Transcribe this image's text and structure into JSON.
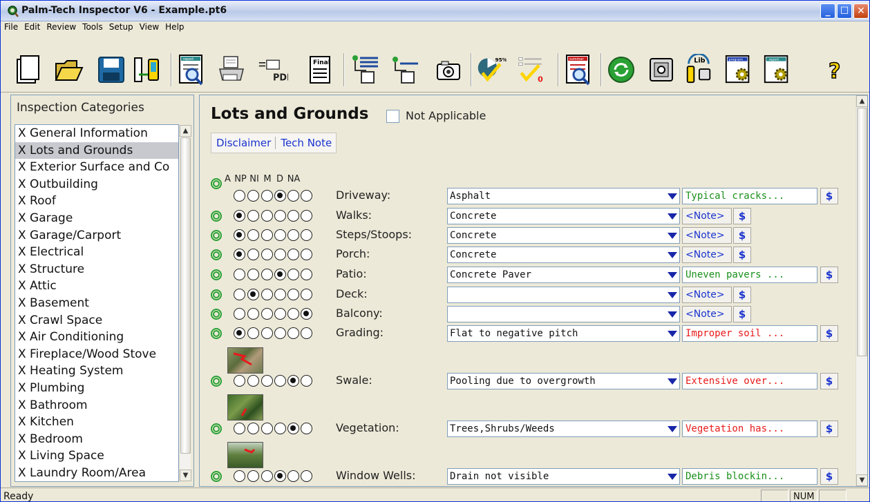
{
  "window": {
    "title": "Palm-Tech Inspector V6 - Example.pt6"
  },
  "menu": [
    "File",
    "Edit",
    "Review",
    "Tools",
    "Setup",
    "View",
    "Help"
  ],
  "toolbar": {
    "report_label": "report",
    "pdf_label": "PDF",
    "final_label": "Final",
    "percent_label": "95%",
    "summary_label": "summar",
    "lib_label": "Lib",
    "program_label": "program",
    "report2_label": "report",
    "help_glyph": "?"
  },
  "sidebar": {
    "title": "Inspection Categories",
    "items": [
      "X  General Information",
      "X  Lots and Grounds",
      "X  Exterior Surface and Co",
      "X  Outbuilding",
      "X  Roof",
      "X  Garage",
      "X  Garage/Carport",
      "X  Electrical",
      "X  Structure",
      "X  Attic",
      "X  Basement",
      "X  Crawl Space",
      "X  Air Conditioning",
      "X  Fireplace/Wood Stove",
      "X  Heating System",
      "X  Plumbing",
      "X  Bathroom",
      "X  Kitchen",
      "X  Bedroom",
      "X  Living Space",
      "X  Laundry Room/Area"
    ],
    "selected_index": 1
  },
  "main": {
    "section_title": "Lots and Grounds",
    "not_applicable_label": "Not Applicable",
    "not_applicable_checked": false,
    "links": {
      "disclaimer": "Disclaimer",
      "tech_note": "Tech Note"
    },
    "columns": [
      "A",
      "NP",
      "NI",
      "M",
      "D",
      "NA"
    ],
    "rows": [
      {
        "label": "Driveway:",
        "rating": "M",
        "value": "Asphalt",
        "comment": "Typical cracks...",
        "comment_color": "green"
      },
      {
        "label": "Walks:",
        "rating": "A",
        "value": "Concrete",
        "comment": "<Note>",
        "comment_color": "note"
      },
      {
        "label": "Steps/Stoops:",
        "rating": "A",
        "value": "Concrete",
        "comment": "<Note>",
        "comment_color": "note"
      },
      {
        "label": "Porch:",
        "rating": "A",
        "value": "Concrete",
        "comment": "<Note>",
        "comment_color": "note"
      },
      {
        "label": "Patio:",
        "rating": "M",
        "value": "Concrete Paver",
        "comment": "Uneven pavers ...",
        "comment_color": "green"
      },
      {
        "label": "Deck:",
        "rating": "NP",
        "value": "",
        "comment": "<Note>",
        "comment_color": "note"
      },
      {
        "label": "Balcony:",
        "rating": "NA",
        "value": "",
        "comment": "<Note>",
        "comment_color": "note"
      },
      {
        "label": "Grading:",
        "rating": "A",
        "value": "Flat to negative pitch",
        "comment": "Improper soil ...",
        "comment_color": "red"
      },
      {
        "label": "Swale:",
        "rating": "D",
        "value": "Pooling due to overgrowth",
        "comment": "Extensive over...",
        "comment_color": "red"
      },
      {
        "label": "Vegetation:",
        "rating": "D",
        "value": "Trees,Shrubs/Weeds",
        "comment": "Vegetation has...",
        "comment_color": "red"
      },
      {
        "label": "Window Wells:",
        "rating": "M",
        "value": "Drain not visible",
        "comment": "Debris blockin...",
        "comment_color": "green"
      }
    ],
    "dollar_label": "$"
  },
  "status": {
    "text": "Ready",
    "num": "NUM"
  },
  "colors": {
    "accent": "#1a33ce",
    "ok_green": "#1a8f1a",
    "defect_red": "#e81a1a",
    "selection": "#c7c9cf"
  }
}
